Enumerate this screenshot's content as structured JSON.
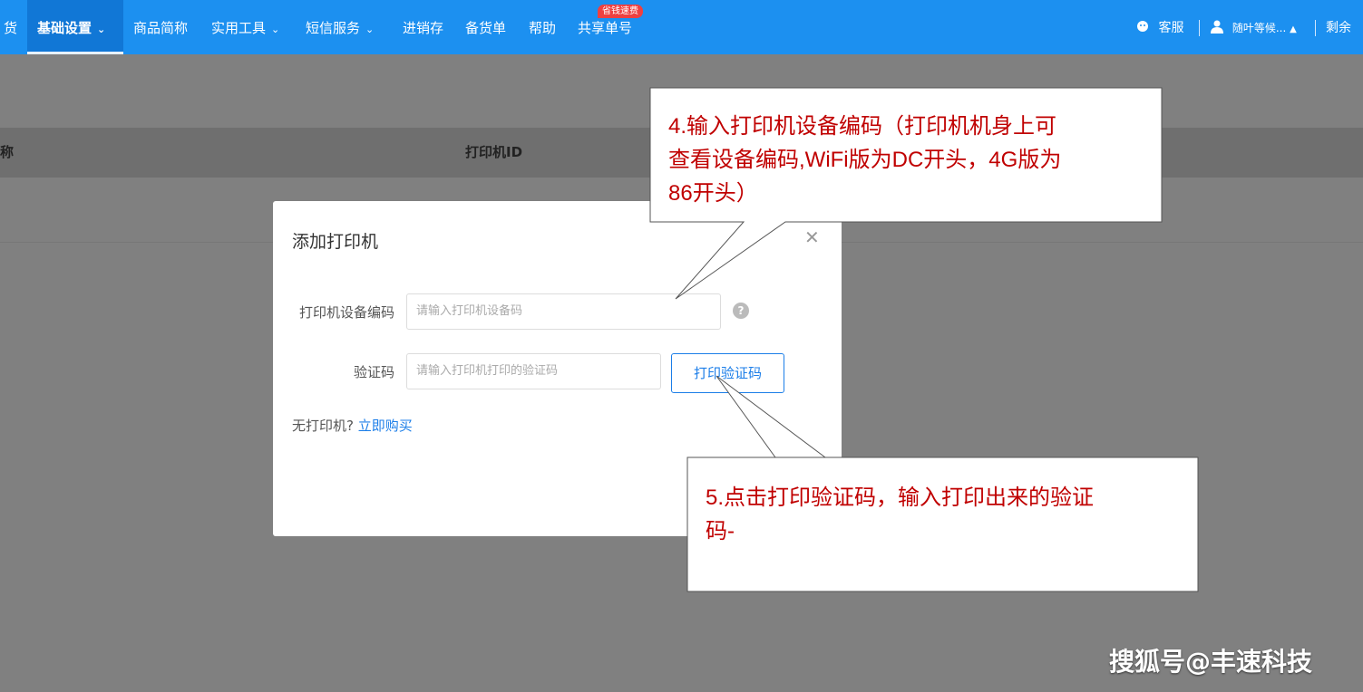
{
  "nav": {
    "items": [
      {
        "label": "货"
      },
      {
        "label": "基础设置",
        "chevron": "chevron-down-icon"
      },
      {
        "label": "商品简称"
      },
      {
        "label": "实用工具",
        "chevron": "chevron-down-icon"
      },
      {
        "label": "短信服务",
        "chevron": "chevron-down-icon"
      },
      {
        "label": "进销存"
      },
      {
        "label": "备货单"
      },
      {
        "label": "帮助"
      },
      {
        "label": "共享单号"
      }
    ],
    "badge": "省钱速费",
    "service_label": "客服",
    "user_label": "随叶等候...",
    "remaining_label": "剩余"
  },
  "table": {
    "col_name": "称",
    "col_printer_id": "打印机ID"
  },
  "modal": {
    "title": "添加打印机",
    "device_code_label": "打印机设备编码",
    "device_code_placeholder": "请输入打印机设备码",
    "verify_label": "验证码",
    "verify_placeholder": "请输入打印机打印的验证码",
    "print_verify_button": "打印验证码",
    "no_printer_text": "无打印机?",
    "buy_link": "立即购买"
  },
  "callouts": {
    "step4_line1": "4.输入打印机设备编码（打印机机身上可",
    "step4_line2": "查看设备编码,WiFi版为DC开头，4G版为",
    "step4_line3": "86开头）",
    "step5_line1": "5.点击打印验证码，输入打印出来的验证",
    "step5_line2": "码-"
  },
  "watermark": "搜狐号@丰速科技",
  "colors": {
    "nav_bg": "#1c90f0",
    "accent": "#1c7ee8",
    "callout_text": "#c00000",
    "overlay": "#808080"
  }
}
